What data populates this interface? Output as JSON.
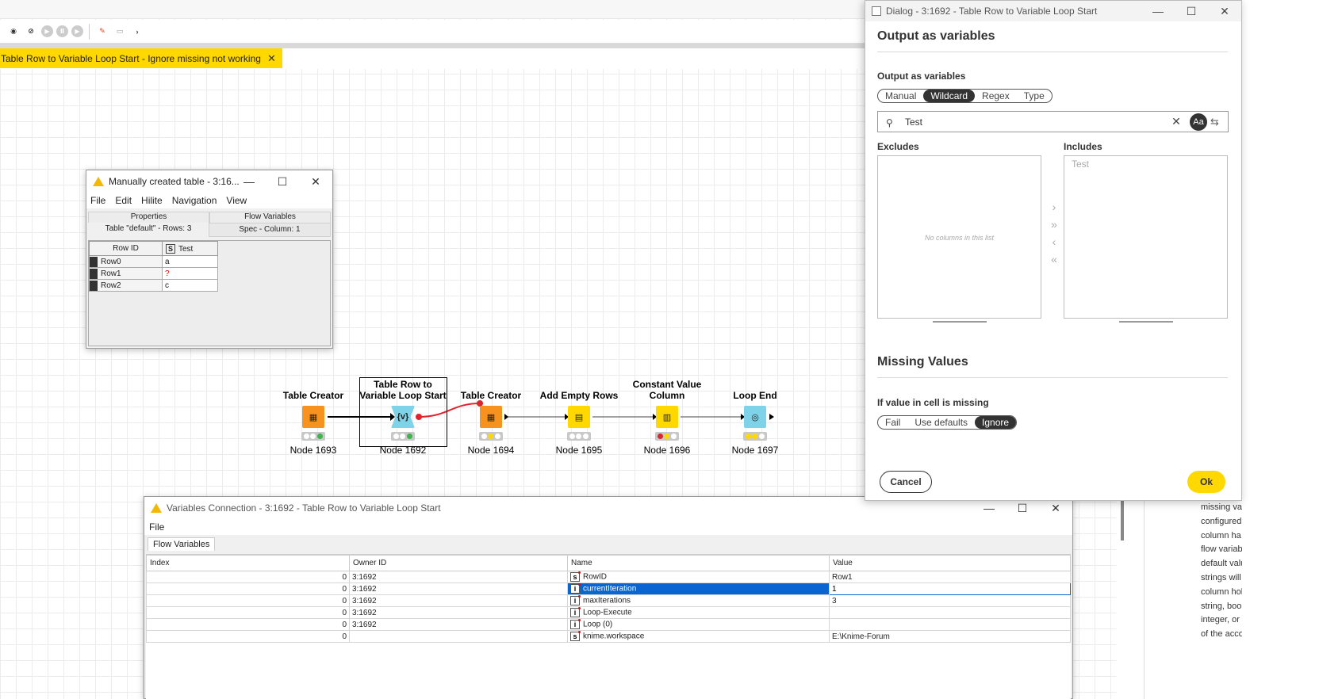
{
  "workflow_tab": {
    "label": "Table Row to Variable Loop Start - Ignore missing not working"
  },
  "toolbar": {
    "icons": [
      "configure-icon",
      "hide-icon",
      "execute-icon",
      "cancel-icon",
      "step-icon",
      "tools-icon",
      "layout-icon",
      "more-icon"
    ]
  },
  "manual_table_window": {
    "title": "Manually created table - 3:16...",
    "menu": [
      "File",
      "Edit",
      "Hilite",
      "Navigation",
      "View"
    ],
    "tabs": [
      "Properties",
      "Flow Variables"
    ],
    "info_left": "Table \"default\" - Rows: 3",
    "info_right": "Spec - Column: 1",
    "columns": [
      "Row ID",
      "Test"
    ],
    "col_type": "S",
    "rows": [
      {
        "id": "Row0",
        "value": "a"
      },
      {
        "id": "Row1",
        "value": "?"
      },
      {
        "id": "Row2",
        "value": "c"
      }
    ]
  },
  "nodes": [
    {
      "name": "Table Creator",
      "label": "Node 1693",
      "color": "#f7921e",
      "glyph": "▦"
    },
    {
      "name": "Table Row to Variable Loop Start",
      "label": "Node 1692",
      "color": "#7fd3e8",
      "glyph": "{v}"
    },
    {
      "name": "Table Creator",
      "label": "Node 1694",
      "color": "#f7921e",
      "glyph": "▦"
    },
    {
      "name": "Add Empty Rows",
      "label": "Node 1695",
      "color": "#ffd800",
      "glyph": "▤"
    },
    {
      "name": "Constant Value Column",
      "label": "Node 1696",
      "color": "#ffd800",
      "glyph": "▥"
    },
    {
      "name": "Loop End",
      "label": "Node 1697",
      "color": "#7fd3e8",
      "glyph": "◎"
    }
  ],
  "variables_window": {
    "title": "Variables Connection - 3:1692 - Table Row to Variable Loop Start",
    "menu": "File",
    "tab": "Flow Variables",
    "columns": [
      "Index",
      "Owner ID",
      "Name",
      "Value"
    ],
    "rows": [
      {
        "index": "0",
        "owner": "3:1692",
        "type": "s",
        "name": "RowID",
        "value": "Row1"
      },
      {
        "index": "0",
        "owner": "3:1692",
        "type": "i",
        "name": "currentIteration",
        "value": "1"
      },
      {
        "index": "0",
        "owner": "3:1692",
        "type": "i",
        "name": "maxIterations",
        "value": "3"
      },
      {
        "index": "0",
        "owner": "3:1692",
        "type": "i",
        "name": "Loop-Execute",
        "value": ""
      },
      {
        "index": "0",
        "owner": "3:1692",
        "type": "i",
        "name": "Loop (0)",
        "value": ""
      },
      {
        "index": "0",
        "owner": "",
        "type": "s",
        "name": "knime.workspace",
        "value": "E:\\Knime-Forum"
      }
    ]
  },
  "dialog": {
    "title": "Dialog - 3:1692 - Table Row to Variable Loop Start",
    "section1": "Output as variables",
    "label1": "Output as variables",
    "modes": [
      "Manual",
      "Wildcard",
      "Regex",
      "Type"
    ],
    "active_mode": "Wildcard",
    "filter_value": "Test",
    "case_toggle": "Aa",
    "excludes_label": "Excludes",
    "includes_label": "Includes",
    "excludes_empty": "No columns in this list",
    "includes_item": "Test",
    "section2": "Missing Values",
    "missing_label": "If value in cell is missing",
    "missing_options": [
      "Fail",
      "Use defaults",
      "Ignore"
    ],
    "missing_active": "Ignore",
    "cancel": "Cancel",
    "ok": "Ok"
  },
  "description_lines": [
    "missing va",
    "configured",
    "column ha",
    "flow variab",
    "default valu",
    "strings will",
    "column hol",
    "string, boo",
    "integer, or",
    "of the acco"
  ]
}
